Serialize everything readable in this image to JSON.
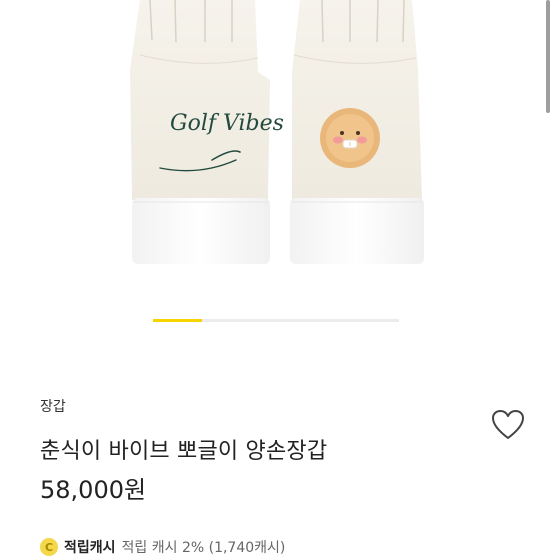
{
  "product": {
    "image_alt": "장갑",
    "embroidery_text": "Golf Vibes",
    "category": "장갑",
    "title": "춘식이 바이브 뽀글이 양손장갑",
    "price": "58,000원"
  },
  "carousel": {
    "progress": 0.2
  },
  "favorite": {
    "icon": "heart-outline-icon"
  },
  "cash": {
    "icon": "C",
    "label": "적립캐시",
    "detail": "적립 캐시 2% (1,740캐시)"
  },
  "colors": {
    "accent": "#f5d400",
    "glove": "#f3efe5",
    "cuff": "#fbfbfb",
    "embroidery": "#244a3f"
  }
}
